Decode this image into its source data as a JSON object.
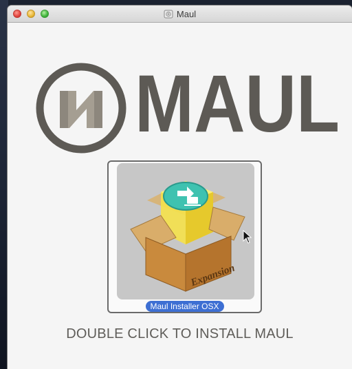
{
  "window": {
    "title": "Maul"
  },
  "logo": {
    "brand_text": "MAUL",
    "colors": {
      "primary": "#5d5a55",
      "accent": "#a59e92"
    }
  },
  "installer": {
    "file_label": "Maul Installer OSX",
    "box_text": "Expansion"
  },
  "instruction": "DOUBLE CLICK TO INSTALL MAUL",
  "colors": {
    "selection": "#3d6fd3",
    "background": "#f5f5f5"
  }
}
